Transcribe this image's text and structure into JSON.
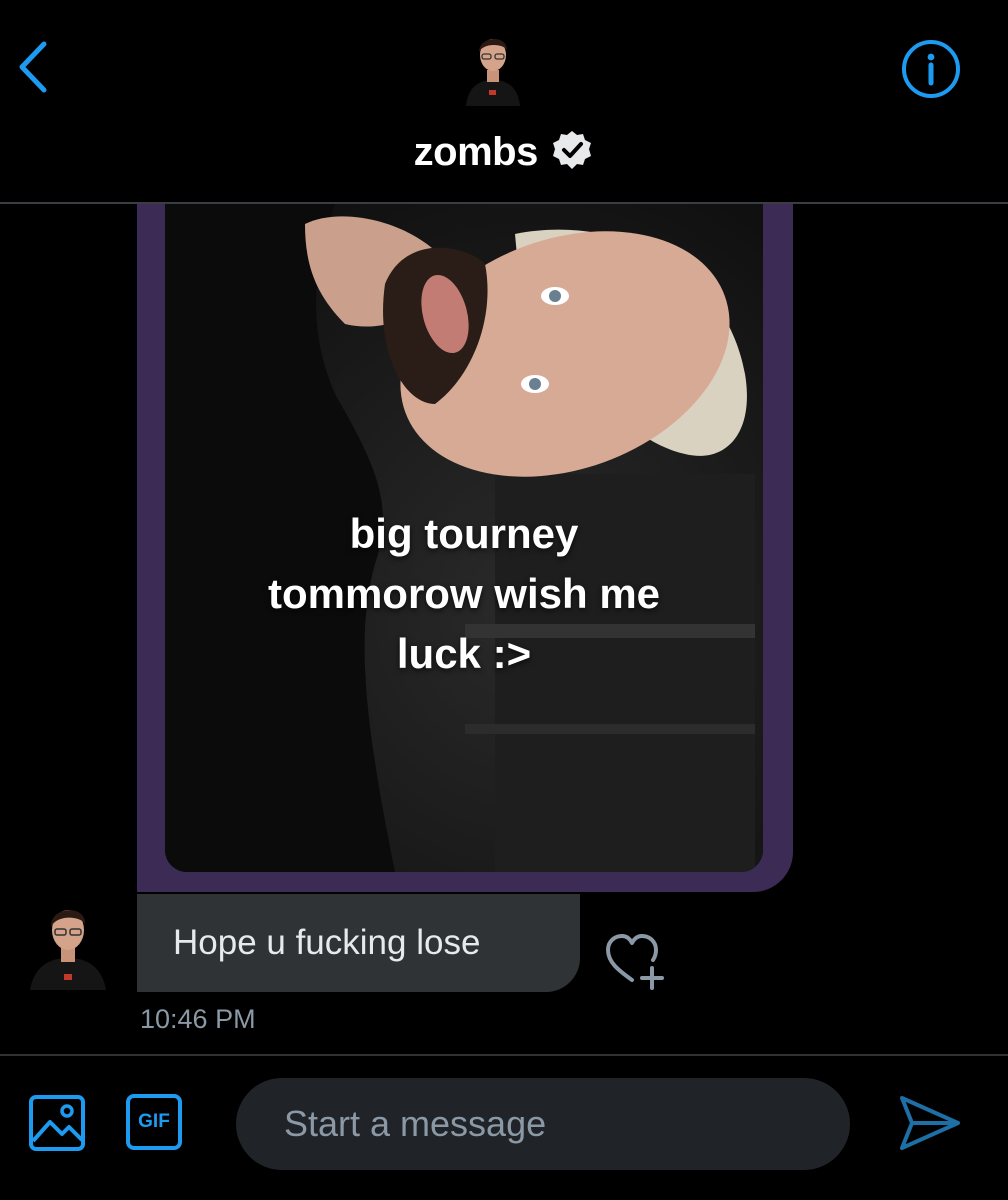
{
  "header": {
    "contact_name": "zombs",
    "verified": true,
    "back_icon": "chevron-left-icon",
    "info_icon": "info-icon",
    "accent_color": "#1d9bf0"
  },
  "conversation": {
    "shared_media": {
      "caption_lines": [
        "big tourney",
        "tommorow wish me",
        "luck :>"
      ],
      "card_color": "#3c2b55"
    },
    "message": {
      "text": "Hope u fucking lose",
      "timestamp": "10:46 PM",
      "like_icon": "heart-plus-icon"
    }
  },
  "composer": {
    "placeholder": "Start a message",
    "gif_label": "GIF",
    "image_icon": "image-icon",
    "send_icon": "send-icon"
  }
}
